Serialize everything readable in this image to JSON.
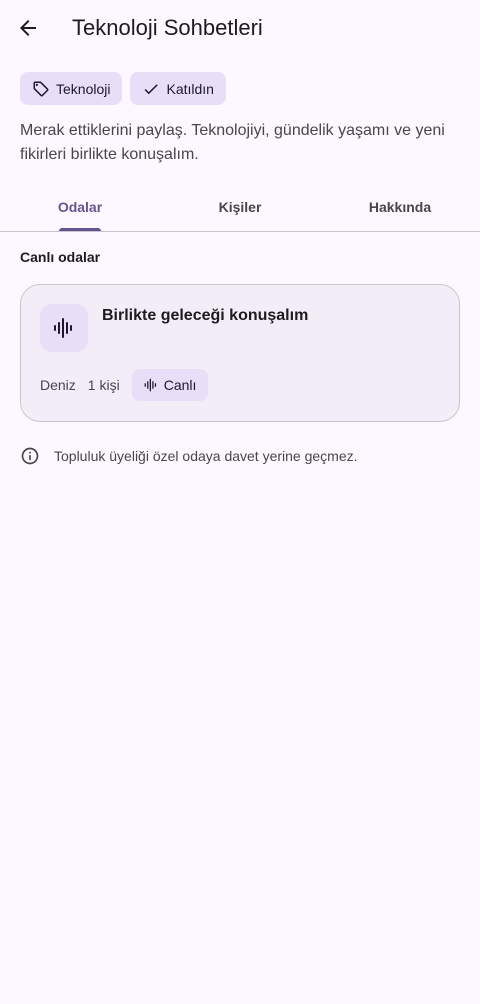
{
  "header": {
    "title": "Teknoloji Sohbetleri"
  },
  "chips": [
    {
      "label": "Teknoloji",
      "icon": "tag-icon"
    },
    {
      "label": "Katıldın",
      "icon": "check-icon"
    }
  ],
  "description": "Merak ettiklerini paylaş. Teknolojiyi, gündelik yaşamı ve yeni fikirleri birlikte konuşalım.",
  "tabs": [
    {
      "label": "Odalar",
      "active": true
    },
    {
      "label": "Kişiler",
      "active": false
    },
    {
      "label": "Hakkında",
      "active": false
    }
  ],
  "live_rooms": {
    "section_label": "Canlı odalar",
    "rooms": [
      {
        "title": "Birlikte geleceği konuşalım",
        "host": "Deniz",
        "participants": "1 kişi",
        "status": "Canlı",
        "icon": "audio-wave-icon"
      }
    ]
  },
  "info": {
    "icon": "info-icon",
    "text": "Topluluk üyeliği özel odaya davet yerine geçmez."
  },
  "colors": {
    "background": "#fdf7ff",
    "accent": "#65558f",
    "chip": "#e8def8",
    "card": "#f3edf7"
  }
}
